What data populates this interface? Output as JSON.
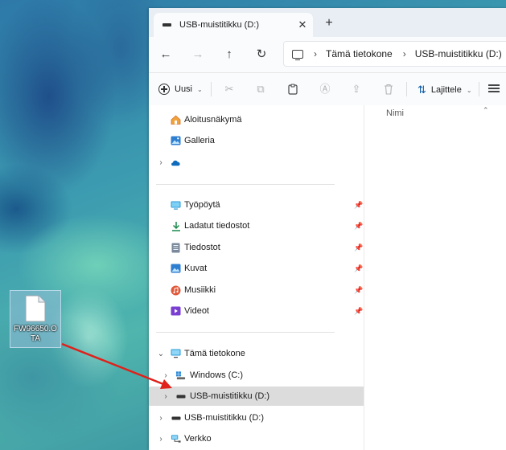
{
  "desktop": {
    "file_icon": {
      "label": "FW96650.OTA",
      "icon": "file-icon"
    }
  },
  "window": {
    "tab": {
      "title": "USB-muistitikku (D:)",
      "close_glyph": "✕",
      "icon": "drive-icon"
    },
    "new_tab_glyph": "+",
    "nav": {
      "back_glyph": "←",
      "forward_glyph": "→",
      "up_glyph": "↑",
      "refresh_glyph": "↻"
    },
    "breadcrumb": {
      "sep": "›",
      "items": [
        "Tämä tietokone",
        "USB-muistitikku (D:)"
      ]
    },
    "toolbar": {
      "new_label": "Uusi",
      "new_chevron": "⌄",
      "sort_label": "Lajittele",
      "sort_chevron": "⌄",
      "sort_glyph": "⇅",
      "icons": {
        "cut": "✂",
        "copy": "⧉",
        "paste": "📋",
        "rename": "Ⓐ",
        "share": "⇪",
        "delete": "🗑"
      }
    },
    "nav_pane": {
      "quick": [
        {
          "label": "Aloitusnäkymä",
          "icon": "home-icon",
          "color": "#e8702a"
        },
        {
          "label": "Galleria",
          "icon": "gallery-icon",
          "color": "#2f7fd0"
        },
        {
          "label": "",
          "icon": "onedrive-icon",
          "color": "#0f6cbd"
        }
      ],
      "pinned": [
        {
          "label": "Työpöytä",
          "icon": "desktop-icon",
          "color": "#2a9bd8"
        },
        {
          "label": "Ladatut tiedostot",
          "icon": "download-icon",
          "color": "#1a8a4a"
        },
        {
          "label": "Tiedostot",
          "icon": "documents-icon",
          "color": "#6a7a8c"
        },
        {
          "label": "Kuvat",
          "icon": "pictures-icon",
          "color": "#2f7fd0"
        },
        {
          "label": "Musiikki",
          "icon": "music-icon",
          "color": "#e0583a"
        },
        {
          "label": "Videot",
          "icon": "videos-icon",
          "color": "#7a3fd0"
        }
      ],
      "pin_glyph": "📌",
      "this_pc": {
        "label": "Tämä tietokone",
        "icon": "computer-icon",
        "color": "#2a9bd8"
      },
      "drives": [
        {
          "label": "Windows (C:)",
          "icon": "windows-drive-icon"
        },
        {
          "label": "USB-muistitikku (D:)",
          "icon": "usb-drive-icon",
          "selected": true
        }
      ],
      "extra": [
        {
          "label": "USB-muistitikku (D:)",
          "icon": "usb-drive-icon"
        },
        {
          "label": "Verkko",
          "icon": "network-icon"
        }
      ]
    },
    "content": {
      "column_name": "Nimi",
      "sort_caret": "⌃"
    }
  }
}
